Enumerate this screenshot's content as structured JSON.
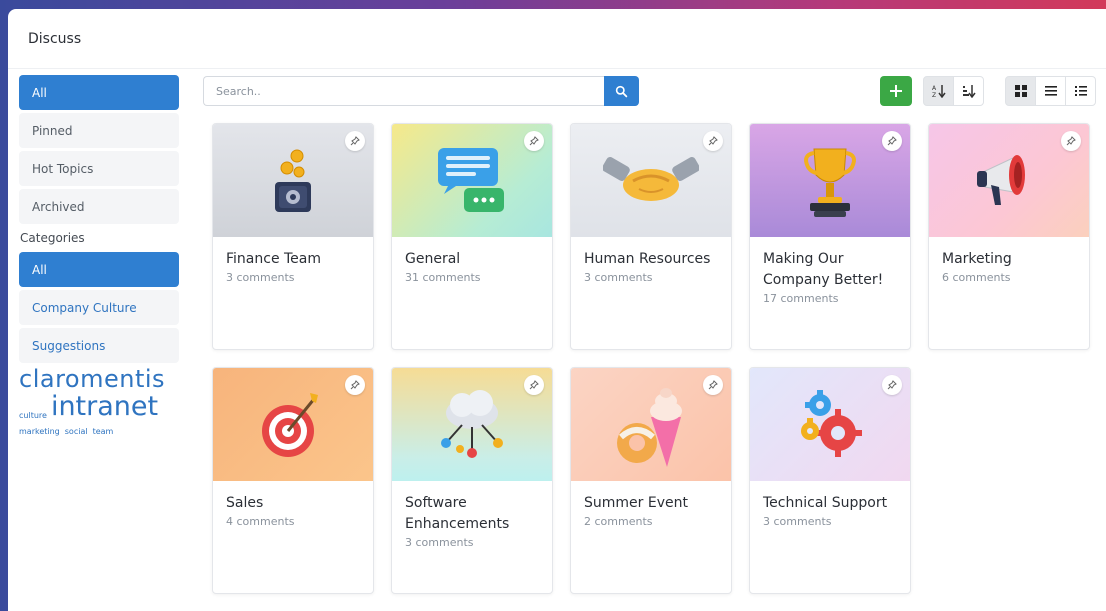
{
  "app": {
    "title": "Discuss"
  },
  "sidebar": {
    "filters": [
      {
        "label": "All",
        "active": true
      },
      {
        "label": "Pinned",
        "active": false
      },
      {
        "label": "Hot Topics",
        "active": false
      },
      {
        "label": "Archived",
        "active": false
      }
    ],
    "categories_header": "Categories",
    "categories": [
      {
        "label": "All",
        "active": true
      },
      {
        "label": "Company Culture",
        "active": false
      },
      {
        "label": "Suggestions",
        "active": false
      }
    ],
    "tags": {
      "big": "claromentis",
      "small_1": "culture",
      "mid": "intranet",
      "small_2": "marketing",
      "small_3": "social",
      "small_4": "team"
    }
  },
  "toolbar": {
    "search_placeholder": "Search..",
    "icons": [
      "plus-icon",
      "sort-alpha-icon",
      "sort-numeric-icon",
      "grid-view-icon",
      "list-view-icon",
      "detail-list-icon"
    ]
  },
  "colors": {
    "accent": "#2f7fd1",
    "add": "#3ba845"
  },
  "cards": [
    {
      "title": "Finance Team",
      "comments": "3 comments",
      "icon": "safe-coins-icon",
      "bg": "linear-gradient(180deg,#e3e5ea,#cfd2d8)"
    },
    {
      "title": "General",
      "comments": "31 comments",
      "icon": "chat-bubbles-icon",
      "bg": "linear-gradient(135deg,#f6e98a,#b6ecd4 70%,#a8e6e0)"
    },
    {
      "title": "Human Resources",
      "comments": "3 comments",
      "icon": "handshake-icon",
      "bg": "linear-gradient(180deg,#eceef2,#dfe2e8)"
    },
    {
      "title": "Making Our Company Better!",
      "comments": "17 comments",
      "icon": "trophy-icon",
      "bg": "linear-gradient(180deg,#d9a6e6,#a98ad8)"
    },
    {
      "title": "Marketing",
      "comments": "6 comments",
      "icon": "megaphone-icon",
      "bg": "linear-gradient(135deg,#f6c6e8,#fcc7d4 60%,#fbd0bd)"
    },
    {
      "title": "Sales",
      "comments": "4 comments",
      "icon": "target-icon",
      "bg": "linear-gradient(135deg,#f7b47c,#fbc58b)"
    },
    {
      "title": "Software Enhancements",
      "comments": "3 comments",
      "icon": "cloud-network-icon",
      "bg": "linear-gradient(180deg,#f6dc95,#c9eee8 80%,#bdf0ee)"
    },
    {
      "title": "Summer Event",
      "comments": "2 comments",
      "icon": "ice-cream-donut-icon",
      "bg": "linear-gradient(135deg,#fbd4c4,#fbc3a9)"
    },
    {
      "title": "Technical Support",
      "comments": "3 comments",
      "icon": "gears-icon",
      "bg": "linear-gradient(135deg,#e2e7fb,#f1d8f0)"
    }
  ]
}
